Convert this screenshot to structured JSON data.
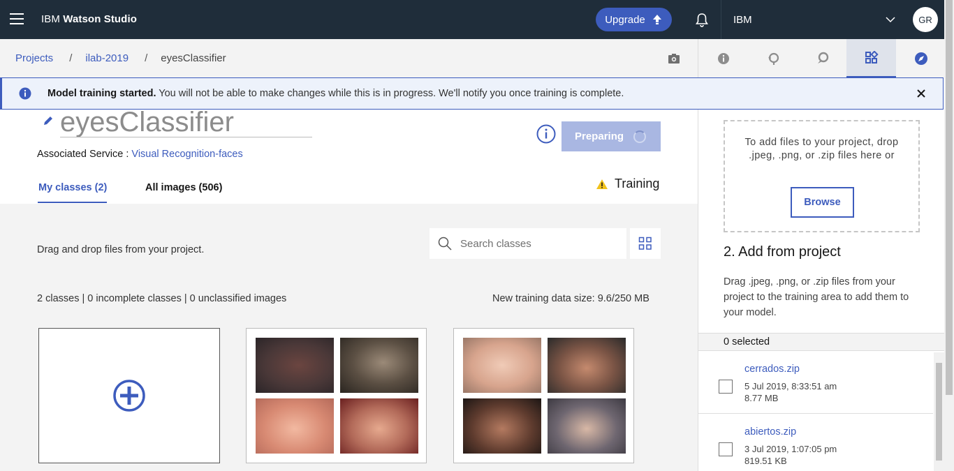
{
  "topbar": {
    "brand_prefix": "IBM",
    "brand_name": "Watson Studio",
    "upgrade_label": "Upgrade",
    "account_label": "IBM",
    "avatar_initials": "GR"
  },
  "breadcrumb": {
    "items": [
      "Projects",
      "ilab-2019",
      "eyesClassifier"
    ],
    "separator": "/"
  },
  "notification": {
    "title": "Model training started.",
    "body": "You will not be able to make changes while this is in progress. We'll notify you once training is complete."
  },
  "model": {
    "title": "eyesClassifier",
    "assoc_label": "Associated Service :",
    "assoc_service": "Visual Recognition-faces",
    "preparing_label": "Preparing",
    "status_label": "Training"
  },
  "tabs": {
    "my_classes": "My classes (2)",
    "all_images": "All images (506)"
  },
  "content": {
    "drag_text": "Drag and drop files from your project.",
    "search_placeholder": "Search classes",
    "stats": "2 classes | 0 incomplete classes | 0 unclassified images",
    "size": "New training data size: 9.6/250 MB"
  },
  "right_panel": {
    "dropzone_text": "To add files to your project, drop .jpeg, .png, or .zip files here or",
    "browse_label": "Browse",
    "add_title": "2. Add from project",
    "add_desc": "Drag .jpeg, .png, or .zip files from your project to the training area to add them to your model.",
    "selected": "0 selected",
    "files": [
      {
        "name": "cerrados.zip",
        "date": "5 Jul 2019, 8:33:51 am",
        "size": "8.77 MB"
      },
      {
        "name": "abiertos.zip",
        "date": "3 Jul 2019, 1:07:05 pm",
        "size": "819.51 KB"
      }
    ]
  },
  "colors": {
    "topbar": "#1f2d3a",
    "accent": "#3d5cbd",
    "preparing_button": "#a9b7e2",
    "warning": "#f1c21b"
  }
}
